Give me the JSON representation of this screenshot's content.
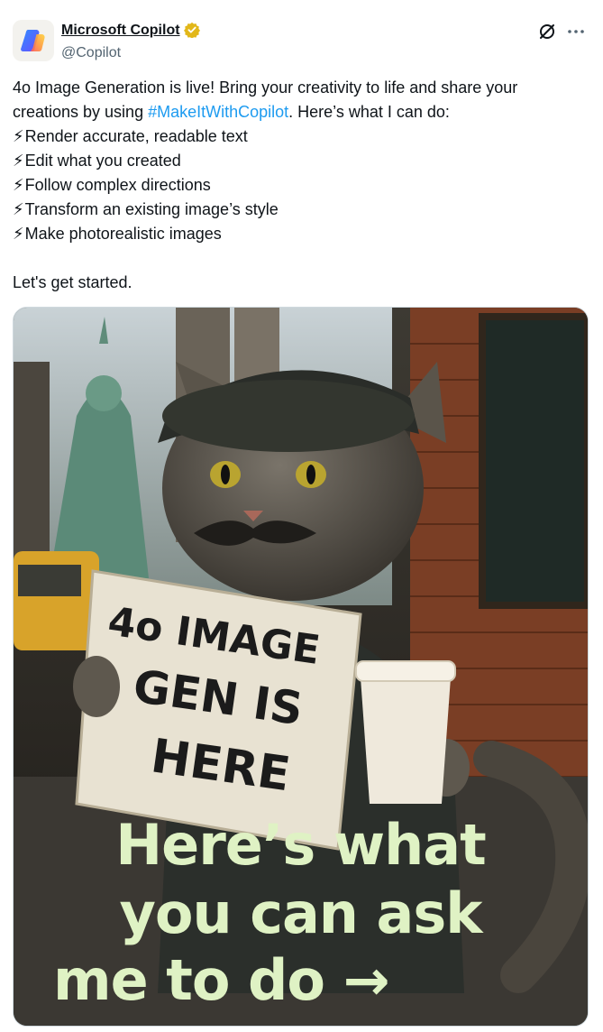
{
  "author": {
    "display_name": "Microsoft Copilot",
    "handle": "@Copilot",
    "verified": true,
    "avatar_icon": "copilot-logo-icon"
  },
  "actions": {
    "grok_icon": "grok-icon",
    "more_icon": "more-icon"
  },
  "tweet": {
    "intro_part1": "4o Image Generation is live! Bring your creativity to life and share your creations by using ",
    "hashtag": "#MakeItWithCopilot",
    "intro_part2": ". Here’s what I can do:",
    "bolt": "⚡",
    "capabilities": [
      "Render accurate, readable text",
      "Edit what you created",
      "Follow complex directions",
      "Transform an existing image’s style",
      "Make photorealistic images"
    ],
    "outro": "Let's get started."
  },
  "media": {
    "sign_lines": [
      "4o IMAGE",
      "GEN IS",
      "HERE"
    ],
    "overlay_lines": [
      "Here’s what",
      "you can ask",
      "me to do →"
    ],
    "colors": {
      "overlay_text": "#dff2c4",
      "hashtag": "#1d9bf0",
      "verified": "#e2b719"
    }
  }
}
